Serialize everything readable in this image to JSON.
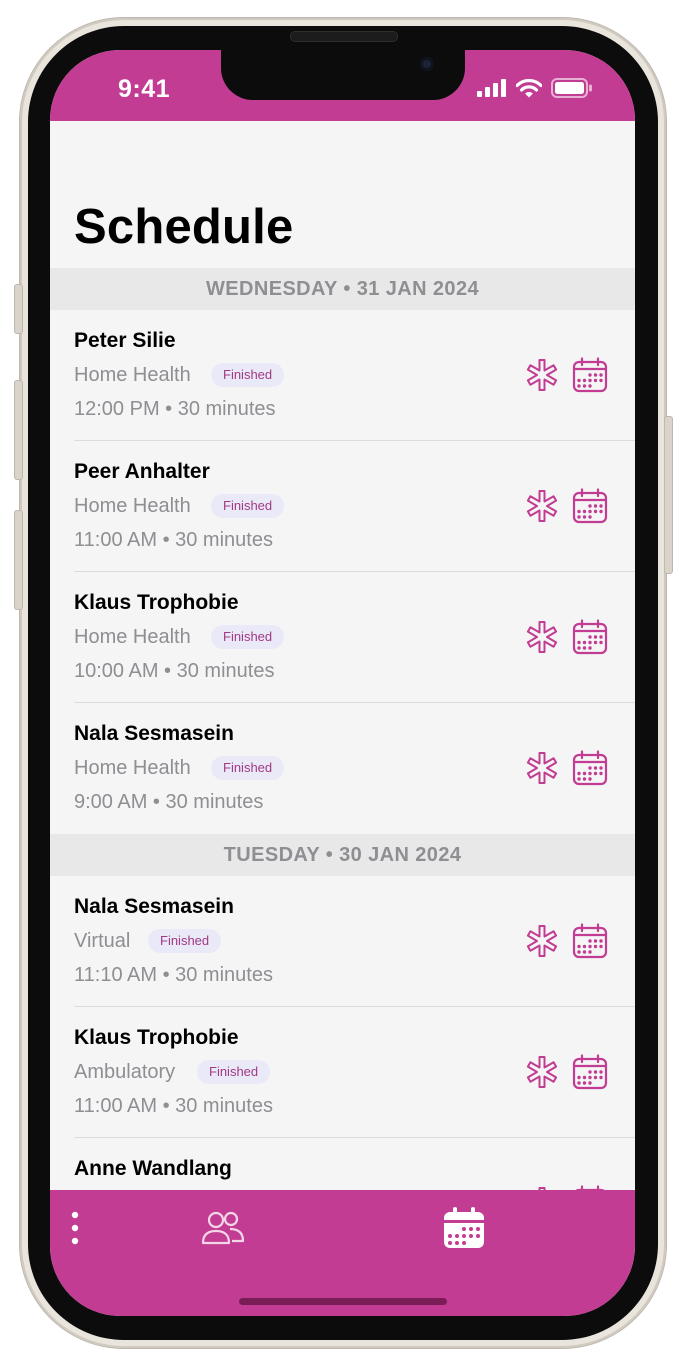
{
  "status": {
    "time": "9:41"
  },
  "page": {
    "title": "Schedule"
  },
  "sections": [
    {
      "label": "WEDNESDAY • 31 JAN 2024",
      "appointments": [
        {
          "name": "Peter Silie",
          "type": "Home Health",
          "status": "Finished",
          "time": "12:00 PM • 30 minutes"
        },
        {
          "name": "Peer Anhalter",
          "type": "Home Health",
          "status": "Finished",
          "time": "11:00 AM • 30 minutes"
        },
        {
          "name": "Klaus Trophobie",
          "type": "Home Health",
          "status": "Finished",
          "time": "10:00 AM • 30 minutes"
        },
        {
          "name": "Nala Sesmasein",
          "type": "Home Health",
          "status": "Finished",
          "time": "9:00 AM • 30 minutes"
        }
      ]
    },
    {
      "label": "TUESDAY • 30 JAN 2024",
      "appointments": [
        {
          "name": "Nala Sesmasein",
          "type": "Virtual",
          "status": "Finished",
          "time": "11:10 AM • 30 minutes"
        },
        {
          "name": "Klaus Trophobie",
          "type": "Ambulatory",
          "status": "Finished",
          "time": "11:00 AM • 30 minutes"
        },
        {
          "name": "Anne Wandlang",
          "type": "",
          "status": "",
          "time": ""
        }
      ]
    }
  ],
  "icons": {
    "row_action_1": "medical-star-icon",
    "row_action_2": "calendar-icon",
    "tab_more": "more-vertical-icon",
    "tab_patients": "people-icon",
    "tab_schedule": "calendar-filled-icon"
  },
  "colors": {
    "brand": "#c23c93",
    "icon": "#c23c93",
    "badge_bg": "#eae9f7",
    "badge_text": "#a13a84",
    "secondary_text": "#8e8e93",
    "section_bg": "#e8e8e8"
  }
}
